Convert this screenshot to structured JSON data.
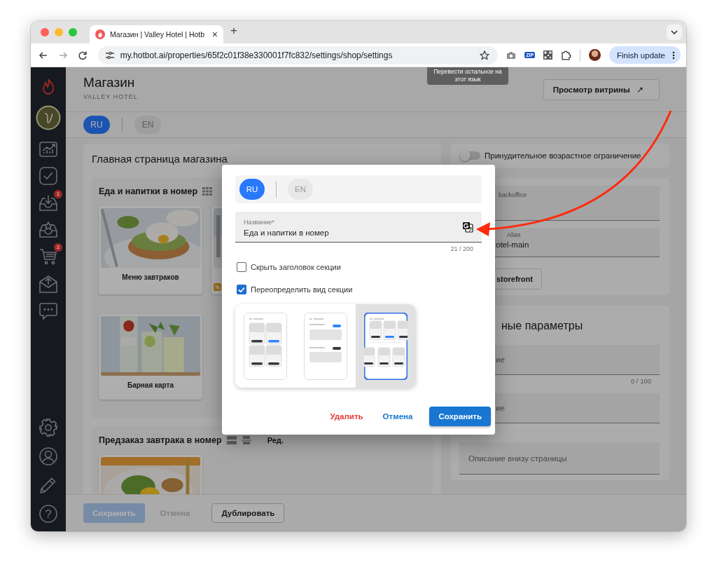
{
  "browser": {
    "tab_title": "Магазин | Valley Hotel | Hotb",
    "tab_close": "×",
    "new_tab": "+",
    "url": "my.hotbot.ai/properties/65f2c01f38e330001f7fc832/settings/shop/settings",
    "extension_label": "ZIP",
    "update_button": "Finish update"
  },
  "sidebar": {
    "top": [
      {
        "kind": "logo"
      },
      {
        "kind": "avatar"
      },
      {
        "kind": "analytics"
      },
      {
        "kind": "tasks"
      },
      {
        "kind": "inbox",
        "badge": "1"
      },
      {
        "kind": "reviews"
      },
      {
        "kind": "cart",
        "badge": "2"
      },
      {
        "kind": "mail"
      },
      {
        "kind": "chat"
      }
    ],
    "bottom": [
      {
        "kind": "settings"
      },
      {
        "kind": "user"
      },
      {
        "kind": "edit"
      },
      {
        "kind": "help",
        "glyph": "?"
      }
    ]
  },
  "header": {
    "title": "Магазин",
    "subtitle": "VALLEY HOTEL",
    "storefront_button": "Просмотр витрины",
    "storefront_arrow": "↗"
  },
  "languages": [
    {
      "label": "RU",
      "selected": true
    },
    {
      "label": "EN",
      "selected": false
    }
  ],
  "tooltip": "Перевести остальное на этот язык",
  "main_card": {
    "title": "Главная страница магазина",
    "section_1": {
      "title": "Еда и напитки в номер",
      "items": [
        {
          "label": "Меню завтраков"
        },
        {
          "badge": "%"
        },
        {
          "label": "Барная карта"
        }
      ]
    },
    "section_2": {
      "title": "Предзаказ завтрака в номер",
      "edit": "Ред."
    }
  },
  "settings": {
    "age_toggle": {
      "label": "Принудительное возрастное ограничение",
      "on": false
    },
    "backoffice_label": "backoffice",
    "alias_label": "Alias",
    "alias_value": "otel-main",
    "storefront_button": "storefront",
    "params_title": "ные параметры",
    "field_1": "ие",
    "field_1_counter": "0 / 100",
    "field_2": "ие",
    "footer_field": "Описание внизу страницы"
  },
  "footer": {
    "buttons": [
      {
        "label": "Сохранить",
        "kind": "primary",
        "disabled": true
      },
      {
        "label": "Отмена",
        "kind": "text",
        "disabled": true
      },
      {
        "label": "Дублировать",
        "kind": "outlined",
        "disabled": false
      }
    ]
  },
  "dialog": {
    "languages": [
      {
        "label": "RU",
        "selected": true
      },
      {
        "label": "EN",
        "selected": false
      }
    ],
    "name_field": {
      "label": "Название*",
      "value": "Еда и напитки в номер",
      "counter": "21 / 200"
    },
    "options": [
      {
        "label": "Скрыть заголовок секции",
        "checked": false
      },
      {
        "label": "Переопределить вид секции",
        "checked": true
      }
    ],
    "layouts": [
      {
        "kind": "grid",
        "selected": false
      },
      {
        "kind": "list",
        "selected": false
      },
      {
        "kind": "carousel",
        "selected": true
      }
    ],
    "buttons": [
      {
        "label": "Удалить",
        "kind": "danger"
      },
      {
        "label": "Отмена",
        "kind": "text"
      },
      {
        "label": "Сохранить",
        "kind": "primary"
      }
    ]
  }
}
